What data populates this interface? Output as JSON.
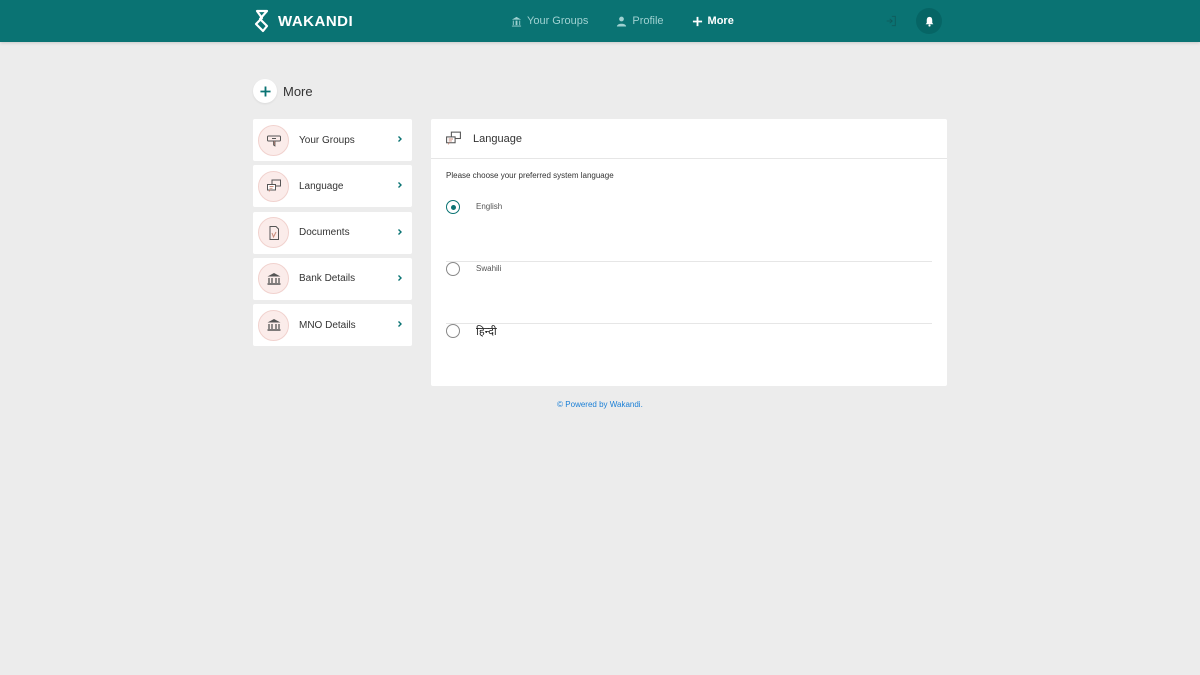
{
  "brand": {
    "name": "WAKANDI"
  },
  "nav": {
    "items": [
      {
        "label": "Your Groups",
        "icon": "bank-icon",
        "active": false
      },
      {
        "label": "Profile",
        "icon": "user-icon",
        "active": false
      },
      {
        "label": "More",
        "icon": "plus-icon",
        "active": true
      }
    ]
  },
  "page": {
    "title": "More"
  },
  "sidebar": {
    "items": [
      {
        "label": "Your Groups",
        "icon": "groups-icon"
      },
      {
        "label": "Language",
        "icon": "language-icon"
      },
      {
        "label": "Documents",
        "icon": "documents-icon"
      },
      {
        "label": "Bank Details",
        "icon": "bank-icon"
      },
      {
        "label": "MNO Details",
        "icon": "bank-icon"
      }
    ]
  },
  "panel": {
    "title": "Language",
    "subtitle": "Please choose your preferred system language",
    "options": [
      {
        "label": "English",
        "selected": true
      },
      {
        "label": "Swahili",
        "selected": false
      },
      {
        "label": "हिन्दी",
        "selected": false
      }
    ]
  },
  "footer": {
    "text": "© Powered by Wakandi."
  },
  "colors": {
    "primary": "#0a7373",
    "background": "#ececec",
    "icon_bg": "#fbecea",
    "link": "#1a7fd6"
  }
}
